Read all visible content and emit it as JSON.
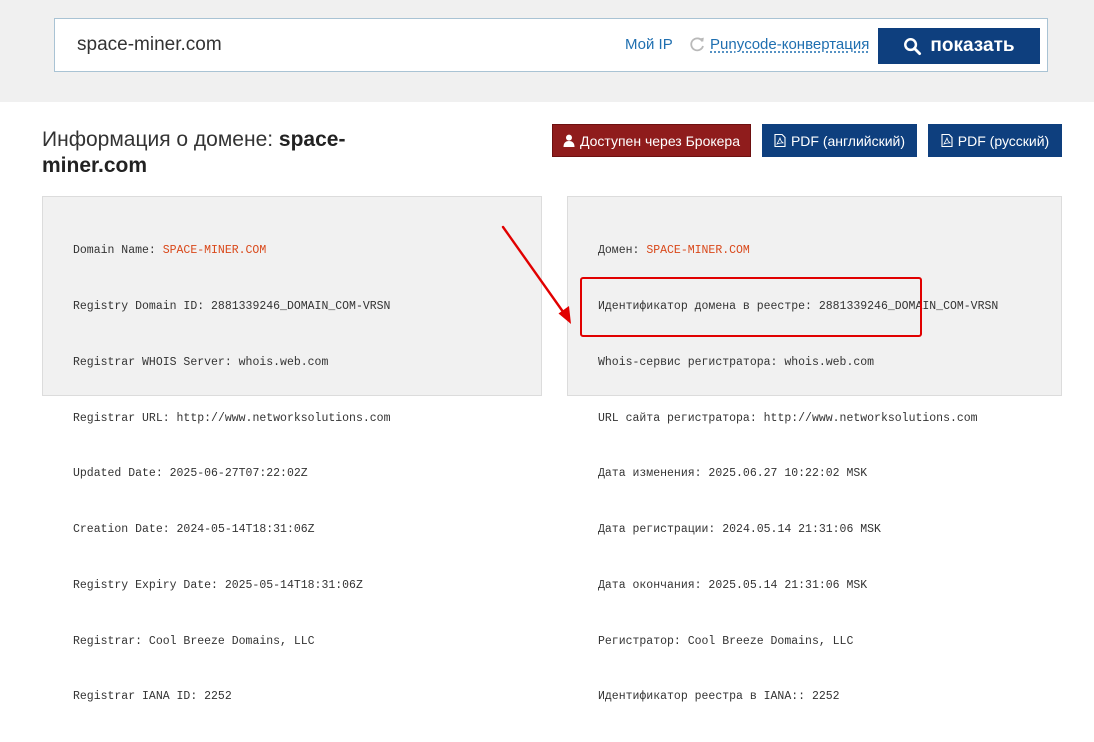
{
  "search": {
    "value": "space-miner.com",
    "my_ip_label": "Мой IP",
    "punycode_label": "Punycode-конвертация",
    "show_button_label": "показать"
  },
  "header": {
    "title_prefix": "Информация о домене: ",
    "title_domain": "space-miner.com"
  },
  "actions": {
    "broker_label": "Доступен через Брокера",
    "pdf_en_label": "PDF (английский)",
    "pdf_ru_label": "PDF (русский)"
  },
  "whois_en": [
    {
      "label": "Domain Name: ",
      "value": "SPACE-MINER.COM"
    },
    {
      "label": "Registry Domain ID: ",
      "value": "2881339246_DOMAIN_COM-VRSN"
    },
    {
      "label": "Registrar WHOIS Server: ",
      "value": "whois.web.com"
    },
    {
      "label": "Registrar URL: ",
      "value": "http://www.networksolutions.com"
    },
    {
      "label": "Updated Date: ",
      "value": "2025-06-27T07:22:02Z"
    },
    {
      "label": "Creation Date: ",
      "value": "2024-05-14T18:31:06Z"
    },
    {
      "label": "Registry Expiry Date: ",
      "value": "2025-05-14T18:31:06Z"
    },
    {
      "label": "Registrar: ",
      "value": "Cool Breeze Domains, LLC"
    },
    {
      "label": "Registrar IANA ID: ",
      "value": "2252"
    }
  ],
  "whois_ru": [
    {
      "label": "Домен: ",
      "value": "SPACE-MINER.COM"
    },
    {
      "label": "Идентификатор домена в реестре: ",
      "value": "2881339246_DOMAIN_COM-VRSN"
    },
    {
      "label": "Whois-сервис регистратора: ",
      "value": "whois.web.com"
    },
    {
      "label": "URL сайта регистратора: ",
      "value": "http://www.networksolutions.com"
    },
    {
      "label": "Дата изменения: ",
      "value": "2025.06.27 10:22:02 MSK"
    },
    {
      "label": "Дата регистрации: ",
      "value": "2024.05.14 21:31:06 MSK"
    },
    {
      "label": "Дата окончания: ",
      "value": "2025.05.14 21:31:06 MSK"
    },
    {
      "label": "Регистратор: ",
      "value": "Cool Breeze Domains, LLC"
    },
    {
      "label": "Идентификатор реестра в IANA:: ",
      "value": "2252"
    }
  ],
  "colors": {
    "link": "#1f6fb0",
    "primary_button": "#0e3f7e",
    "broker_button": "#8f1c1c",
    "domain_highlight": "#d9481a",
    "annotation_red": "#e10000"
  },
  "icons": {
    "refresh": "refresh-icon",
    "search": "search-icon",
    "user": "user-icon",
    "pdf": "pdf-file-icon"
  }
}
